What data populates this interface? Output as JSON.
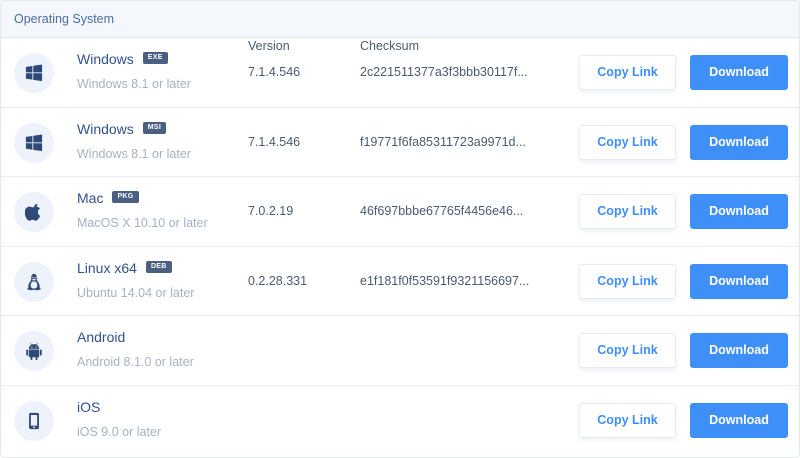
{
  "header": {
    "os": "Operating System",
    "version": "Version",
    "checksum": "Checksum"
  },
  "rows": [
    {
      "icon": "windows-icon",
      "name": "Windows",
      "badge": "EXE",
      "requirement": "Windows 8.1 or later",
      "version": "7.1.4.546",
      "checksum": "2c221511377a3f3bbb30117f...",
      "copy_label": "Copy Link",
      "download_label": "Download"
    },
    {
      "icon": "windows-icon",
      "name": "Windows",
      "badge": "MSI",
      "requirement": "Windows 8.1 or later",
      "version": "7.1.4.546",
      "checksum": "f19771f6fa85311723a9971d...",
      "copy_label": "Copy Link",
      "download_label": "Download"
    },
    {
      "icon": "apple-icon",
      "name": "Mac",
      "badge": "PKG",
      "requirement": "MacOS X 10.10 or later",
      "version": "7.0.2.19",
      "checksum": "46f697bbbe67765f4456e46...",
      "copy_label": "Copy Link",
      "download_label": "Download"
    },
    {
      "icon": "linux-icon",
      "name": "Linux x64",
      "badge": "DEB",
      "requirement": "Ubuntu 14.04 or later",
      "version": "0.2.28.331",
      "checksum": "e1f181f0f53591f9321156697...",
      "copy_label": "Copy Link",
      "download_label": "Download"
    },
    {
      "icon": "android-icon",
      "name": "Android",
      "badge": "",
      "requirement": "Android 8.1.0 or later",
      "version": "",
      "checksum": "",
      "copy_label": "Copy Link",
      "download_label": "Download"
    },
    {
      "icon": "phone-icon",
      "name": "iOS",
      "badge": "",
      "requirement": "iOS 9.0 or later",
      "version": "",
      "checksum": "",
      "copy_label": "Copy Link",
      "download_label": "Download"
    }
  ],
  "colors": {
    "accent": "#3f8ff8",
    "badge": "#4a5f82",
    "header_bg": "#f4f7fc"
  }
}
